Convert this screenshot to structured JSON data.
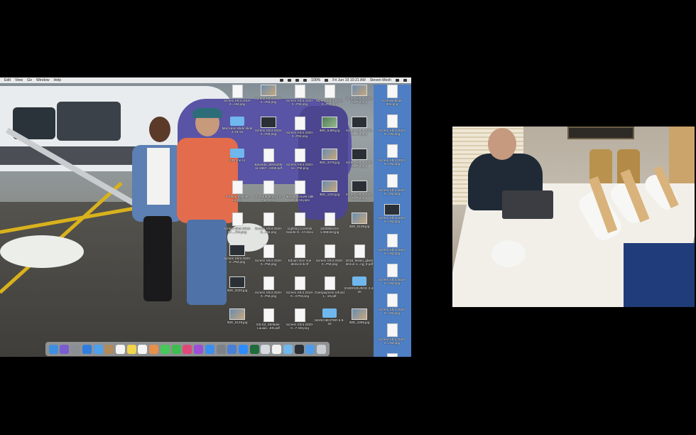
{
  "menubar": {
    "items": [
      "Edit",
      "View",
      "Go",
      "Window",
      "Help"
    ],
    "battery": "100%",
    "clock": "Fri Jun 19  10:21 AM",
    "user": "Steven Mesh"
  },
  "desktop_icons": [
    {
      "label": "Screen Shot 2019-0...AM.png",
      "kind": "doc"
    },
    {
      "label": "Screen Shot 2019-0...PM.png",
      "kind": "pic"
    },
    {
      "label": "Screen Shot 2020-0...PM.png",
      "kind": "doc"
    },
    {
      "label": "Screen Shot 2020-0...PM.png",
      "kind": "doc"
    },
    {
      "label": "Screen Shot 2020-0...PM.png",
      "kind": "pic"
    },
    {
      "label": "Mod Hem Webr slide 4-16-19",
      "kind": "folder"
    },
    {
      "label": "Screen Shot 2019-0...PM.png",
      "kind": "dark"
    },
    {
      "label": "Screen Shot 2020-0...PM.png",
      "kind": "doc"
    },
    {
      "label": "IMG_5498.jpg",
      "kind": "green"
    },
    {
      "label": "Screen Shot 2020-0...PM.png",
      "kind": "dark"
    },
    {
      "label": "S Drone 11",
      "kind": "folder"
    },
    {
      "label": "Bavarda_SEE5205 11.1567...1069.pdf",
      "kind": "doc"
    },
    {
      "label": "Screen Shot 2020-12...PM.png",
      "kind": "doc"
    },
    {
      "label": "IMG_3278.jpg",
      "kind": "pic"
    },
    {
      "label": "Screen Shot 2020-0...PM.png",
      "kind": "dark"
    },
    {
      "label": "X-Plane Installer Log.txt",
      "kind": "doc"
    },
    {
      "label": "Vive Vue demo info 7-11-19.txt",
      "kind": "doc"
    },
    {
      "label": "IES Vancouver talk 11-28-19.pptx",
      "kind": "doc"
    },
    {
      "label": "IMG_1234.jpg",
      "kind": "pic"
    },
    {
      "label": "Screen Shot 2020-0...PM.png",
      "kind": "dark"
    },
    {
      "label": "Screen Shot 2019-07....PM.png",
      "kind": "doc"
    },
    {
      "label": "Screen Shot 2020-0...PM.png",
      "kind": "doc"
    },
    {
      "label": "Lighting Controls Hands-O...1Y.docx",
      "kind": "doc"
    },
    {
      "label": "2020061019 1.358153.jpg",
      "kind": "doc"
    },
    {
      "label": "IMG_5139.jpg",
      "kind": "pic"
    },
    {
      "label": "Screen Shot 2020-0...PM.png",
      "kind": "dark"
    },
    {
      "label": "Screen Shot 2020-0...PM.png",
      "kind": "doc"
    },
    {
      "label": "Eduan Vive Vue demo link.rtf",
      "kind": "doc"
    },
    {
      "label": "Screen Shot 2020-0...PM.png",
      "kind": "doc"
    },
    {
      "label": "2018_feisen_glass lemon-1...ng_9.pdf",
      "kind": "doc"
    },
    {
      "label": "IMG_2020.jpg",
      "kind": "dark"
    },
    {
      "label": "Screen Shot 2020-0...PM.png",
      "kind": "doc"
    },
    {
      "label": "Screen Shot 2019-0...3 PM.png",
      "kind": "doc"
    },
    {
      "label": "Overpayment refund 1...18.pdf",
      "kind": "doc"
    },
    {
      "label": "EVERSOURCE 2-4-20",
      "kind": "folder"
    },
    {
      "label": "IMG_5129.jpg",
      "kind": "pic"
    },
    {
      "label": "GE-03_Stefanie-Lauian...EN.pdf",
      "kind": "doc"
    },
    {
      "label": "Screen Shot 2020-0...7 AM.png",
      "kind": "doc"
    },
    {
      "label": "MANCHESTER 5-5-20",
      "kind": "folder"
    },
    {
      "label": "IMG_3265.jpg",
      "kind": "pic"
    }
  ],
  "blue_column_icons": [
    {
      "label": "GoToWebinar 001.png",
      "kind": "doc"
    },
    {
      "label": "Screen Shot 2020-0...AM.png",
      "kind": "doc"
    },
    {
      "label": "Screen Shot 2020-0...AM.png",
      "kind": "doc"
    },
    {
      "label": "Screen Shot 2020-0...AM.png",
      "kind": "doc"
    },
    {
      "label": "Screen Shot 2020-0...AM.png",
      "kind": "dark"
    },
    {
      "label": "Screen Shot 2020-0...AM.png",
      "kind": "doc"
    },
    {
      "label": "Screen Shot 2020-0...AM.png",
      "kind": "doc"
    },
    {
      "label": "Screen Shot 2020-0...AM.png",
      "kind": "doc"
    },
    {
      "label": "Screen Shot 2020-0...AM.png",
      "kind": "doc"
    },
    {
      "label": "GoToWebinar 006.png",
      "kind": "doc"
    }
  ],
  "dock_apps": [
    {
      "icon": "finder-icon",
      "color": "#3f8fe0"
    },
    {
      "icon": "siri-icon",
      "color": "#7a5cd1"
    },
    {
      "icon": "launchpad-icon",
      "color": "#8a8f96"
    },
    {
      "icon": "safari-icon",
      "color": "#2f7de0"
    },
    {
      "icon": "mail-icon",
      "color": "#4da1ea"
    },
    {
      "icon": "contacts-icon",
      "color": "#b08a5c"
    },
    {
      "icon": "calendar-icon",
      "color": "#f4f4f4"
    },
    {
      "icon": "notes-icon",
      "color": "#f1d54b"
    },
    {
      "icon": "reminders-icon",
      "color": "#f5f5f5"
    },
    {
      "icon": "photos-icon",
      "color": "#e6904b"
    },
    {
      "icon": "messages-icon",
      "color": "#46c85a"
    },
    {
      "icon": "facetime-icon",
      "color": "#3fbd4e"
    },
    {
      "icon": "itunes-icon",
      "color": "#e2477a"
    },
    {
      "icon": "podcasts-icon",
      "color": "#9d4fd7"
    },
    {
      "icon": "appstore-icon",
      "color": "#3a8ef0"
    },
    {
      "icon": "preferences-icon",
      "color": "#7d8188"
    },
    {
      "icon": "presentation-icon",
      "color": "#4a7fd6"
    },
    {
      "icon": "zoom-icon",
      "color": "#2d8cff"
    },
    {
      "icon": "solitaire-icon",
      "color": "#1e6b3c"
    },
    {
      "icon": "preview-icon",
      "color": "#d6d9de"
    },
    {
      "icon": "textedit-icon",
      "color": "#f2f2f2"
    },
    {
      "icon": "folder-icon",
      "color": "#6fb7ec"
    },
    {
      "icon": "screen-icon",
      "color": "#2b2f36"
    },
    {
      "icon": "downloads-icon",
      "color": "#4f9be8"
    },
    {
      "icon": "trash-icon",
      "color": "#c9ccd1"
    }
  ]
}
